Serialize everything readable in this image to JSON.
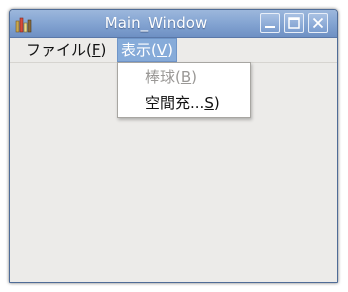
{
  "window": {
    "title": "Main_Window",
    "title_icon": "app-icon"
  },
  "title_buttons": {
    "minimize_icon": "minimize-icon",
    "maximize_icon": "maximize-icon",
    "close_icon": "close-icon"
  },
  "menubar": {
    "file": {
      "text": "ファイル(",
      "mnemonic": "F",
      "tail": ")"
    },
    "view": {
      "text": "表示(",
      "mnemonic": "V",
      "tail": ")"
    }
  },
  "view_menu": {
    "items": [
      {
        "text": "棒球(",
        "mnemonic": "B",
        "tail": ")",
        "enabled": false
      },
      {
        "text": "空間充...",
        "mnemonic": "S",
        "tail": ")",
        "enabled": true
      }
    ]
  },
  "colors": {
    "titlebar": "#86a6d3",
    "menu_highlight": "#86abd9",
    "window_bg": "#ecebe9",
    "disabled_text": "#9a9896"
  }
}
